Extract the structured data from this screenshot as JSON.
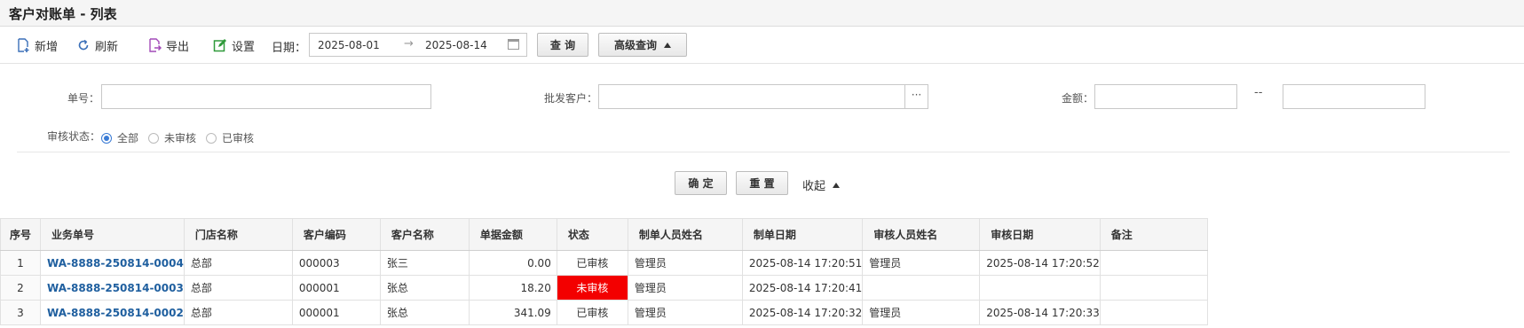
{
  "page": {
    "title": "客户对账单 - 列表"
  },
  "toolbar": {
    "add_label": "新增",
    "refresh_label": "刷新",
    "export_label": "导出",
    "settings_label": "设置",
    "date_label": "日期：",
    "date_from": "2025-08-01",
    "date_arrow": "→",
    "date_to": "2025-08-14",
    "query_label": "查 询",
    "advanced_label": "高级查询"
  },
  "advanced": {
    "order_no_label": "单号：",
    "order_no_value": "",
    "customer_label": "批发客户：",
    "customer_value": "",
    "customer_picker": "···",
    "amount_label": "金额：",
    "amount_from": "",
    "amount_sep": "--",
    "amount_to": "",
    "status_label": "审核状态：",
    "status_options": [
      "全部",
      "未审核",
      "已审核"
    ],
    "status_selected": "全部",
    "confirm_label": "确 定",
    "reset_label": "重 置",
    "collapse_label": "收起"
  },
  "colors": {
    "link": "#1f5f9f",
    "unreviewed_bg": "#f30000",
    "radio_on": "#3a7bd5"
  },
  "table": {
    "columns": [
      "序号",
      "业务单号",
      "门店名称",
      "客户编码",
      "客户名称",
      "单据金额",
      "状态",
      "制单人员姓名",
      "制单日期",
      "审核人员姓名",
      "审核日期",
      "备注"
    ],
    "rows": [
      [
        "1",
        "WA-8888-250814-0004",
        "总部",
        "000003",
        "张三",
        "0.00",
        "已审核",
        "管理员",
        "2025-08-14 17:20:51",
        "管理员",
        "2025-08-14 17:20:52",
        ""
      ],
      [
        "2",
        "WA-8888-250814-0003",
        "总部",
        "000001",
        "张总",
        "18.20",
        "未审核",
        "管理员",
        "2025-08-14 17:20:41",
        "",
        "",
        ""
      ],
      [
        "3",
        "WA-8888-250814-0002",
        "总部",
        "000001",
        "张总",
        "341.09",
        "已审核",
        "管理员",
        "2025-08-14 17:20:32",
        "管理员",
        "2025-08-14 17:20:33",
        ""
      ]
    ]
  }
}
